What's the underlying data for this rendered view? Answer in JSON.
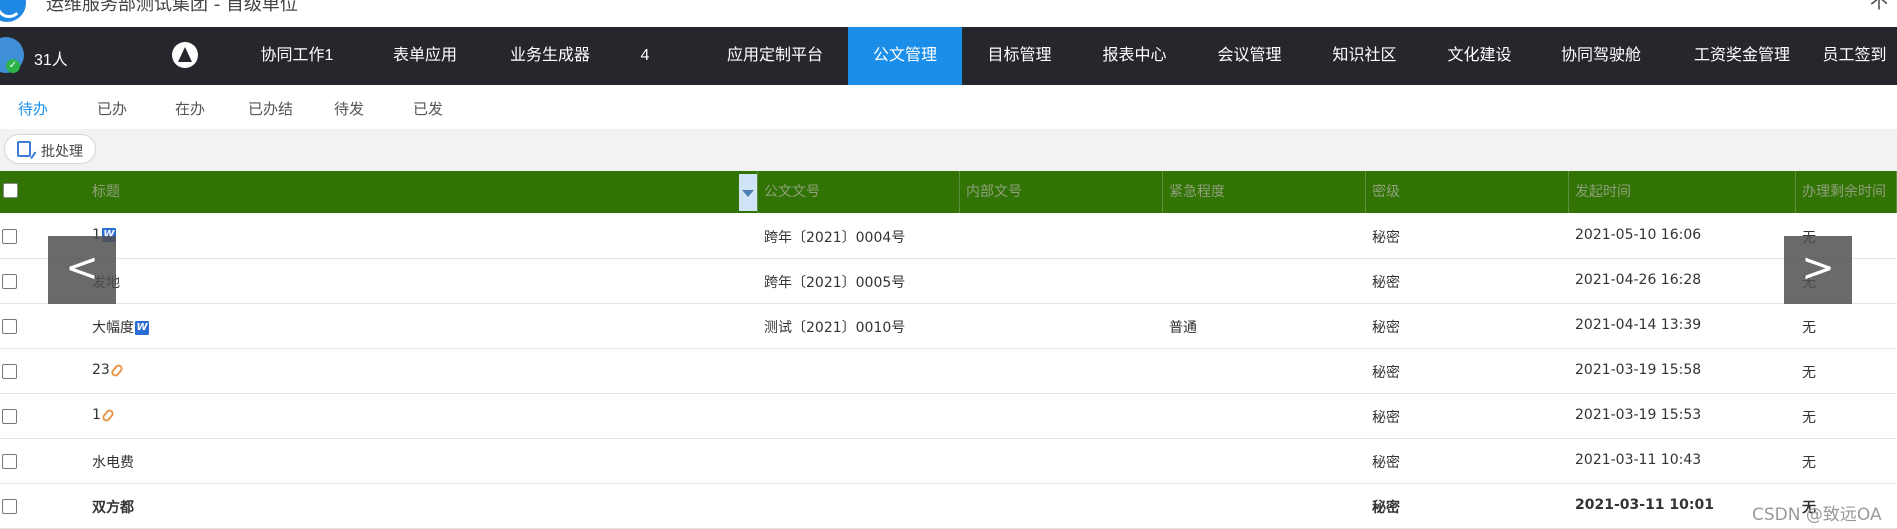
{
  "topbar": {
    "title": "运维服务部测试集团 - 首级单位",
    "dropdown": "⌄",
    "right_text": "不"
  },
  "navbar": {
    "people_count": "31人",
    "items": [
      {
        "label": "协同工作1"
      },
      {
        "label": "表单应用"
      },
      {
        "label": "业务生成器"
      },
      {
        "label": "4"
      },
      {
        "label": "应用定制平台"
      },
      {
        "label": "公文管理"
      },
      {
        "label": "目标管理"
      },
      {
        "label": "报表中心"
      },
      {
        "label": "会议管理"
      },
      {
        "label": "知识社区"
      },
      {
        "label": "文化建设"
      },
      {
        "label": "协同驾驶舱"
      },
      {
        "label": "工资奖金管理"
      },
      {
        "label": "员工签到"
      }
    ],
    "active_index": 5,
    "active_color": "#1a8ee8"
  },
  "tabs": [
    "待办",
    "已办",
    "在办",
    "已办结",
    "待发",
    "已发"
  ],
  "toolbar": {
    "batch_label": "批处理"
  },
  "table": {
    "header_color": "#327305",
    "columns": [
      "标题",
      "公文文号",
      "内部文号",
      "紧急程度",
      "密级",
      "发起时间",
      "办理剩余时间"
    ],
    "rows": [
      {
        "title": "1",
        "icon": "word-icon",
        "doc_no": "跨年〔2021〕0004号",
        "internal_no": "",
        "urgency": "",
        "secret": "秘密",
        "time": "2021-05-10 16:06",
        "remaining": "无"
      },
      {
        "title": "发地",
        "icon": "",
        "doc_no": "跨年〔2021〕0005号",
        "internal_no": "",
        "urgency": "",
        "secret": "秘密",
        "time": "2021-04-26 16:28",
        "remaining": "无"
      },
      {
        "title": "大幅度",
        "icon": "word-icon",
        "doc_no": "测试〔2021〕0010号",
        "internal_no": "",
        "urgency": "普通",
        "secret": "秘密",
        "time": "2021-04-14 13:39",
        "remaining": "无"
      },
      {
        "title": "23",
        "icon": "paperclip-icon",
        "doc_no": "",
        "internal_no": "",
        "urgency": "",
        "secret": "秘密",
        "time": "2021-03-19 15:58",
        "remaining": "无"
      },
      {
        "title": "1",
        "icon": "paperclip-icon",
        "doc_no": "",
        "internal_no": "",
        "urgency": "",
        "secret": "秘密",
        "time": "2021-03-19 15:53",
        "remaining": "无"
      },
      {
        "title": "水电费",
        "icon": "",
        "doc_no": "",
        "internal_no": "",
        "urgency": "",
        "secret": "秘密",
        "time": "2021-03-11 10:43",
        "remaining": "无"
      },
      {
        "title": "双方都",
        "icon": "",
        "doc_no": "",
        "internal_no": "",
        "urgency": "",
        "secret": "秘密",
        "time": "2021-03-11 10:01",
        "remaining": "无"
      }
    ]
  },
  "arrows": {
    "prev": "<",
    "next": ">"
  },
  "watermark": "CSDN @致远OA"
}
